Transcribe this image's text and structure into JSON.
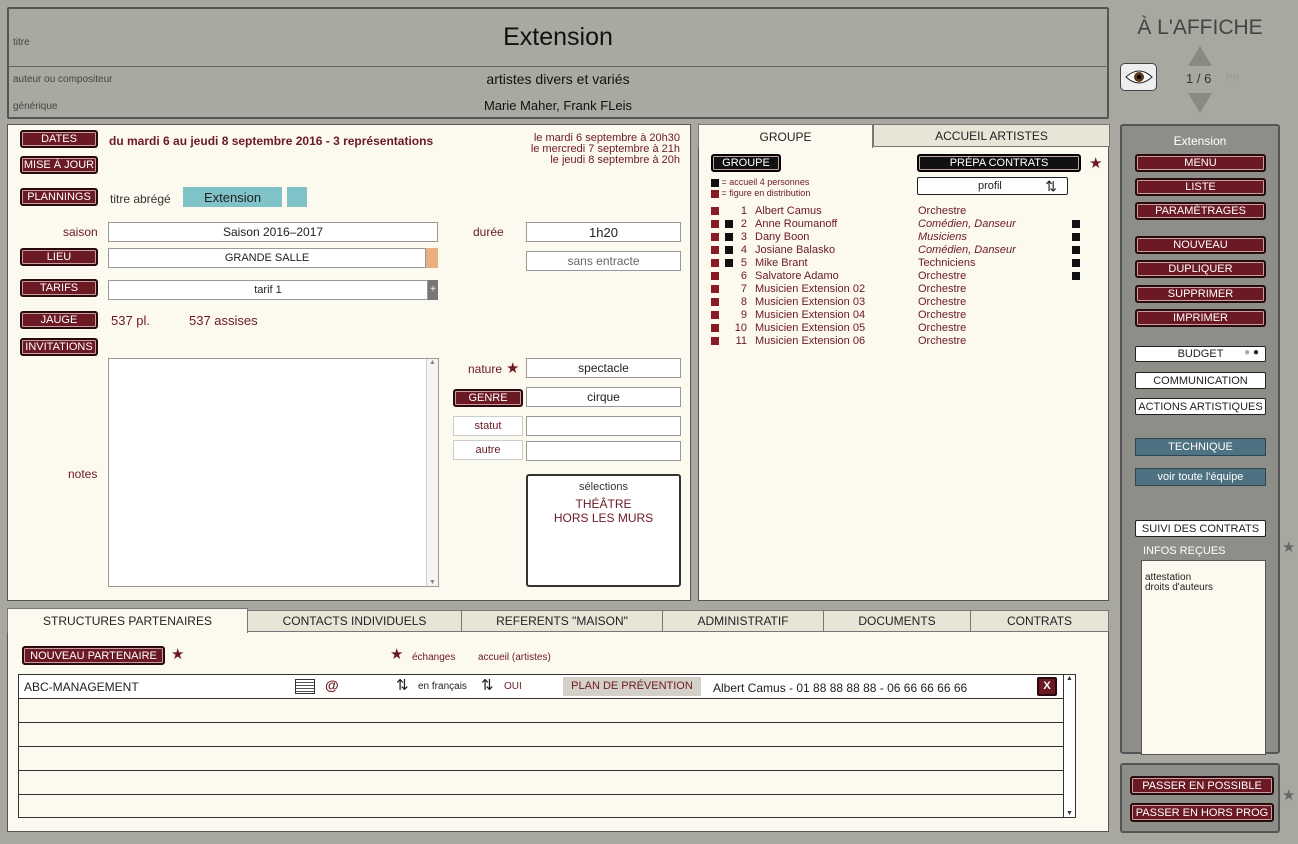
{
  "header": {
    "titre_label": "titre",
    "titre": "Extension",
    "auteur_label": "auteur ou compositeur",
    "auteur": "artistes divers et variés",
    "generique_label": "générique",
    "generique": "Marie Maher, Frank FLeis"
  },
  "brand": {
    "title": "À L'AFFICHE",
    "pager": "1 / 6",
    "pager_suffix": "PR"
  },
  "left": {
    "dates_btn": "DATES",
    "dates_text": "du mardi 6 au jeudi 8 septembre 2016 - 3 représentations",
    "dates_list": [
      "le mardi 6 septembre à 20h30",
      "le mercredi 7 septembre à 21h",
      "le jeudi 8 septembre à 20h"
    ],
    "miseajour_btn": "MISE À JOUR",
    "plannings_btn": "PLANNINGS",
    "titre_abrege_label": "titre abrégé",
    "titre_abrege": "Extension",
    "saison_label": "saison",
    "saison": "Saison 2016–2017",
    "duree_label": "durée",
    "duree": "1h20",
    "entracte": "sans entracte",
    "lieu_btn": "LIEU",
    "lieu": "GRANDE SALLE",
    "tarifs_btn": "TARIFS",
    "tarif": "tarif 1",
    "jauge_btn": "JAUGE",
    "jauge_pl": "537 pl.",
    "jauge_assises": "537 assises",
    "invitations_btn": "INVITATIONS",
    "notes_label": "notes",
    "nature_label": "nature",
    "nature": "spectacle",
    "genre_btn": "GENRE",
    "genre": "cirque",
    "statut_label": "statut",
    "statut": "",
    "autre_label": "autre",
    "autre": "",
    "selections_label": "sélections",
    "selections": [
      "THÉÂTRE",
      "HORS LES MURS"
    ]
  },
  "groupe": {
    "tabs": [
      "GROUPE",
      "ACCUEIL ARTISTES"
    ],
    "groupe_btn": "GROUPE",
    "prepa_btn": "PRÉPA CONTRATS",
    "profil": "profil",
    "legend": [
      "= accueil 4 personnes",
      "= figure en distribution"
    ],
    "members": [
      {
        "n": "1",
        "name": "Albert Camus",
        "role": "Orchestre",
        "italic": false,
        "accueil": false,
        "right": false
      },
      {
        "n": "2",
        "name": "Anne Roumanoff",
        "role": "Comédien, Danseur",
        "italic": true,
        "accueil": true,
        "right": true
      },
      {
        "n": "3",
        "name": "Dany Boon",
        "role": "Musiciens",
        "italic": true,
        "accueil": true,
        "right": true
      },
      {
        "n": "4",
        "name": "Josiane Balasko",
        "role": "Comédien, Danseur",
        "italic": true,
        "accueil": true,
        "right": true
      },
      {
        "n": "5",
        "name": "Mike Brant",
        "role": "Techniciens",
        "italic": false,
        "accueil": true,
        "right": true
      },
      {
        "n": "6",
        "name": "Salvatore Adamo",
        "role": "Orchestre",
        "italic": false,
        "accueil": false,
        "right": true
      },
      {
        "n": "7",
        "name": "Musicien Extension 02",
        "role": "Orchestre",
        "italic": false,
        "accueil": false,
        "right": false
      },
      {
        "n": "8",
        "name": "Musicien Extension 03",
        "role": "Orchestre",
        "italic": false,
        "accueil": false,
        "right": false
      },
      {
        "n": "9",
        "name": "Musicien Extension 04",
        "role": "Orchestre",
        "italic": false,
        "accueil": false,
        "right": false
      },
      {
        "n": "10",
        "name": "Musicien Extension 05",
        "role": "Orchestre",
        "italic": false,
        "accueil": false,
        "right": false
      },
      {
        "n": "11",
        "name": "Musicien Extension 06",
        "role": "Orchestre",
        "italic": false,
        "accueil": false,
        "right": false
      }
    ]
  },
  "sidebar": {
    "title": "Extension",
    "menu": "MENU",
    "liste": "LISTE",
    "parametrages": "PARAMÈTRAGES",
    "nouveau": "NOUVEAU",
    "dupliquer": "DUPLIQUER",
    "supprimer": "SUPPRIMER",
    "imprimer": "IMPRIMER",
    "budget": "BUDGET",
    "communication": "COMMUNICATION",
    "actions": "ACTIONS ARTISTIQUES",
    "technique": "TECHNIQUE",
    "equipe": "voir toute l'équipe",
    "suivi": "SUIVI DES CONTRATS",
    "infos_label": "INFOS REÇUES",
    "infos": [
      "attestation",
      "droits d'auteurs"
    ],
    "possible": "PASSER EN POSSIBLE",
    "horsprog": "PASSER EN HORS PROG"
  },
  "bottom": {
    "tabs": [
      "STRUCTURES PARTENAIRES",
      "CONTACTS INDIVIDUELS",
      "REFERENTS \"MAISON\"",
      "ADMINISTRATIF",
      "DOCUMENTS",
      "CONTRATS"
    ],
    "nouveau_btn": "NOUVEAU PARTENAIRE",
    "echanges": "échanges",
    "accueil": "accueil (artistes)",
    "row": {
      "name": "ABC-MANAGEMENT",
      "lang": "en français",
      "oui": "OUI",
      "plan": "PLAN DE PRÉVENTION",
      "contact": "Albert Camus - 01 88 88 88 88 - 06 66 66 66 66",
      "close": "X"
    }
  }
}
